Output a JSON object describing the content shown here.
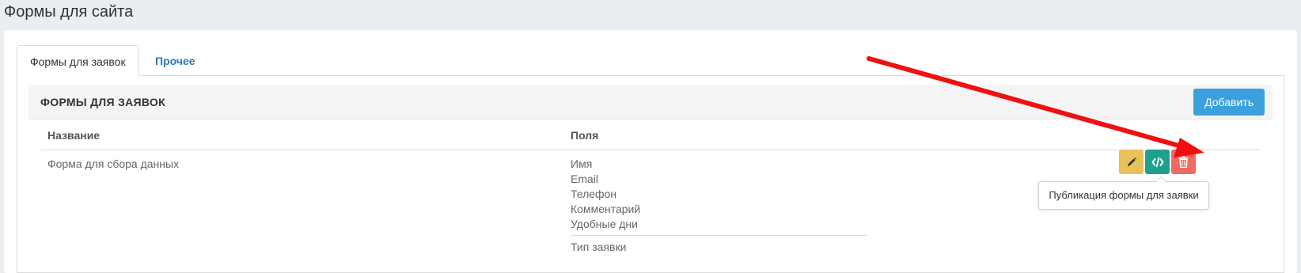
{
  "page": {
    "title": "Формы для сайта"
  },
  "tabs": [
    {
      "label": "Формы для заявок",
      "active": true
    },
    {
      "label": "Прочее",
      "active": false
    }
  ],
  "section": {
    "title": "ФОРМЫ ДЛЯ ЗАЯВОК",
    "add_label": "Добавить"
  },
  "table": {
    "columns": [
      "Название",
      "Поля"
    ],
    "rows": [
      {
        "name": "Форма для сбора данных",
        "fields": [
          "Имя",
          "Email",
          "Телефон",
          "Комментарий",
          "Удобные дни"
        ],
        "extra_field": "Тип заявки"
      }
    ]
  },
  "actions": {
    "edit_icon": "pencil-icon",
    "publish_icon": "code-icon",
    "delete_icon": "trash-icon"
  },
  "tooltip": {
    "text": "Публикация формы для заявки"
  },
  "colors": {
    "accent": "#3ca0dc",
    "edit": "#e8c15a",
    "publish": "#1fa08c",
    "delete": "#ef6a60",
    "annotation_arrow": "#f01010"
  }
}
